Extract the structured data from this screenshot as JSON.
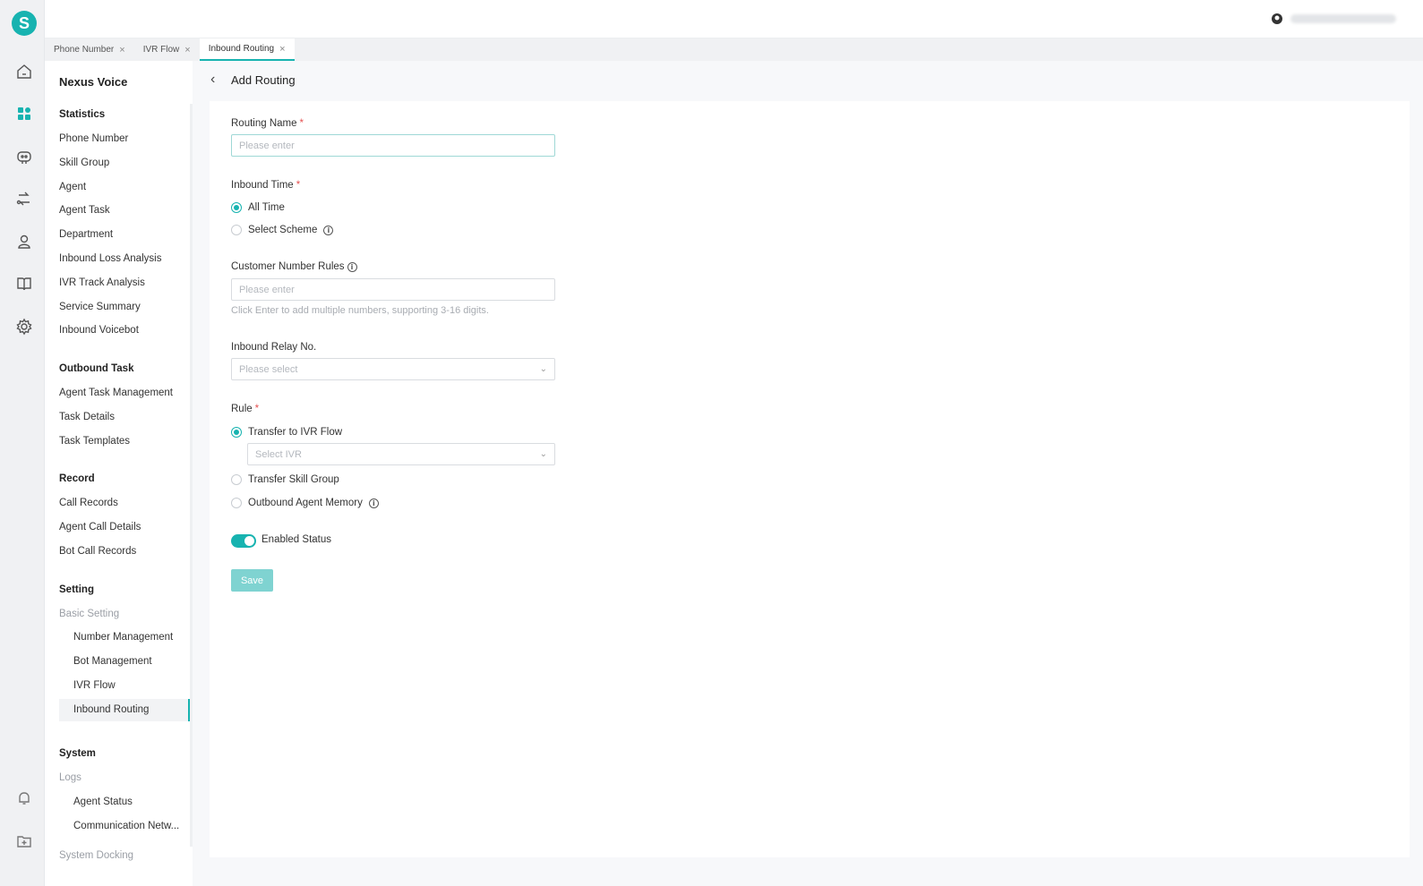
{
  "app": {
    "logo_letter": "S",
    "accent_color": "#17b3b0",
    "user_icon": "user-avatar-icon"
  },
  "rail_icons": [
    "home-icon",
    "dashboard-icon",
    "bot-icon",
    "routing-icon",
    "agent-icon",
    "book-icon",
    "settings-icon",
    "bell-icon",
    "folder-plus-icon"
  ],
  "tabs": [
    {
      "label": "Phone Number",
      "active": false
    },
    {
      "label": "IVR Flow",
      "active": false
    },
    {
      "label": "Inbound Routing",
      "active": true
    }
  ],
  "sidebar": {
    "title": "Nexus Voice",
    "groups": {
      "statistics": "Statistics",
      "outbound": "Outbound Task",
      "record": "Record",
      "setting": "Setting",
      "system": "System"
    },
    "statistics_items": [
      "Phone Number",
      "Skill Group",
      "Agent",
      "Agent Task",
      "Department",
      "Inbound Loss Analysis",
      "IVR Track Analysis",
      "Service Summary",
      "Inbound Voicebot"
    ],
    "outbound_items": [
      "Agent Task Management",
      "Task Details",
      "Task Templates"
    ],
    "record_items": [
      "Call Records",
      "Agent Call Details",
      "Bot Call Records"
    ],
    "basic_setting": "Basic Setting",
    "setting_items": [
      "Number Management",
      "Bot Management",
      "IVR Flow",
      "Inbound Routing"
    ],
    "logs": "Logs",
    "logs_items": [
      "Agent Status",
      "Communication Netw..."
    ],
    "system_docking": "System Docking"
  },
  "page": {
    "title": "Add Routing"
  },
  "form": {
    "routing_name": {
      "label": "Routing Name",
      "placeholder": "Please enter"
    },
    "inbound_time": {
      "label": "Inbound Time",
      "options": [
        "All Time",
        "Select Scheme"
      ],
      "selected": "All Time"
    },
    "customer_rules": {
      "label": "Customer Number Rules",
      "placeholder": "Please enter",
      "hint": "Click Enter to add multiple numbers, supporting 3-16 digits."
    },
    "relay_no": {
      "label": "Inbound Relay No.",
      "placeholder": "Please select"
    },
    "rule": {
      "label": "Rule",
      "options": [
        "Transfer to IVR Flow",
        "Transfer Skill Group",
        "Outbound Agent Memory"
      ],
      "selected": "Transfer to IVR Flow",
      "ivr_placeholder": "Select IVR"
    },
    "enabled": {
      "label": "Enabled Status",
      "on": true
    },
    "save_label": "Save"
  }
}
